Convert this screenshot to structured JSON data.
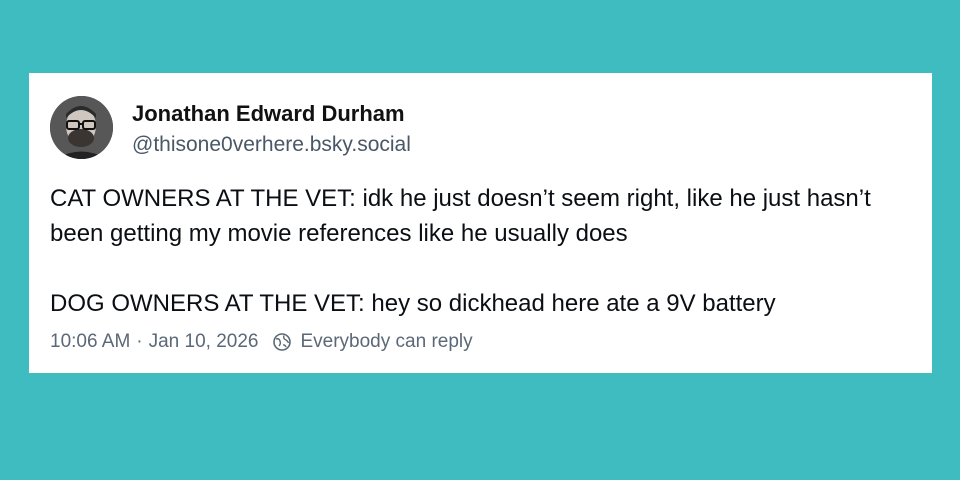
{
  "post": {
    "author": {
      "display_name": "Jonathan Edward Durham",
      "handle": "@thisone0verhere.bsky.social",
      "avatar_icon": "avatar-photo"
    },
    "body": {
      "paragraph_1": "CAT OWNERS AT THE VET: idk he just doesn’t seem right, like he just hasn’t been getting my movie references like he usually does",
      "paragraph_2": "DOG OWNERS AT THE VET: hey so dickhead here ate a 9V battery"
    },
    "meta": {
      "time": "10:06 AM",
      "separator": "·",
      "date": "Jan 10, 2026",
      "reply_setting_icon": "globe-icon",
      "reply_setting": "Everybody can reply"
    }
  },
  "colors": {
    "background": "#3fbcbf",
    "card": "#ffffff",
    "text_primary": "#0b0f14",
    "text_secondary": "#5b6877"
  }
}
